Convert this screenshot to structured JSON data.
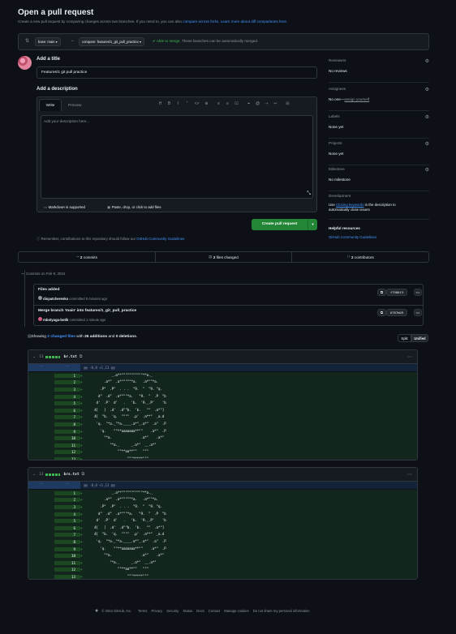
{
  "header": {
    "title": "Open a pull request",
    "subtitle": "Create a new pull request by comparing changes across two branches. If you need to, you can also ",
    "compare_link": "compare across forks.",
    "learn_link": "Learn more about diff comparisons here."
  },
  "compare": {
    "base": "base: main",
    "head": "compare: features/1_git_pull_practice",
    "able": "✔ Able to merge.",
    "able_desc": "These branches can be automatically merged."
  },
  "form": {
    "title_label": "Add a title",
    "title_value": "Features/1 git pull practice",
    "desc_label": "Add a description",
    "tab_write": "Write",
    "tab_preview": "Preview",
    "desc_placeholder": "Add your description here...",
    "markdown_supported": "Markdown is supported",
    "paste_drop": "Paste, drop, or click to add files",
    "create_button": "Create pull request",
    "remember": "Remember, contributions to this repository should follow our ",
    "guidelines": "GitHub Community Guidelines",
    "toolbar_icons": [
      "H",
      "B",
      "I",
      "”",
      "<>",
      "⊕",
      "≡",
      "≡",
      "☑",
      "⌖",
      "@",
      "⇢",
      "↩",
      "⊟"
    ]
  },
  "sidebar": {
    "reviewers": {
      "title": "Reviewers",
      "value": "No reviews"
    },
    "assignees": {
      "title": "Assignees",
      "value": "No one—",
      "link": "assign yourself"
    },
    "labels": {
      "title": "Labels",
      "value": "None yet"
    },
    "projects": {
      "title": "Projects",
      "value": "None yet"
    },
    "milestone": {
      "title": "Milestone",
      "value": "No milestone"
    },
    "development": {
      "title": "Development",
      "desc_pre": "Use ",
      "desc_link": "Closing keywords",
      "desc_post": " in the description to automatically close issues"
    },
    "helpful": {
      "title": "Helpful resources",
      "link": "GitHub Community Guidelines"
    }
  },
  "stats": {
    "commits_num": "2",
    "commits_label": "commits",
    "files_num": "2",
    "files_label": "files changed",
    "contributors_num": "2",
    "contributors_label": "contributors"
  },
  "commits": {
    "date": "Commits on Feb 9, 2024",
    "items": [
      {
        "message": "Files added",
        "author": "dispatcherenko",
        "meta": "committed 9 minutes ago",
        "sha": "f7986f3"
      },
      {
        "message": "Merge branch 'main' into features/1_git_pull_practice",
        "author": "mbotyaga-botik",
        "meta": "committed 1 minute ago",
        "sha": "6787b09"
      }
    ]
  },
  "summary": {
    "showing": "Showing ",
    "files_link": "2 changed files",
    "with": " with ",
    "additions": "26 additions",
    "and": " and ",
    "deletions": "0 deletions",
    "end": ".",
    "split": "Split",
    "unified": "Unified"
  },
  "files": [
    {
      "count": "13",
      "name": "br.txt",
      "hunk": "@@ -0,0 +1,13 @@"
    },
    {
      "count": "13",
      "name": "brs.txt",
      "hunk": "@@ -0,0 +1,13 @@"
    }
  ],
  "ascii_art": [
    "            _.a**\"\"\"\"\"\"\"\"\"\"\"**a._",
    "        .a*\"  .a*\"\"\"\"\"*a.   .a*\"\"*a.",
    "      .P\"  .P\"  . . .  \"9.  \"  \"9. \"q.",
    "     d\"  .d\"  .a*\"\"\"*a.   \"9.  \"  .P  \"b",
    "    d'  .P'  d'   .   'b.  '9._.P'    'b",
    "   4[   [  .d'  .d\"\"b.  'b.   \"\"  .a*\"]",
    "   4[  \"b.  'q.  \"\"\"\"  .p'  .a**\"  _a.d",
    "    'q.  \"*a._\"*a.____.a*\"_.a*\"  .a\"  .P",
    "      'q.    \"\"**aaaaaaa**\"\"    .a*\"  .P",
    "        \"*a.               .a*\"    .a*\"",
    "           \"*a._      _.a*\"  __.a*\"",
    "               \"\"**aa**\"\"   \"\"\"",
    "                    \"\"\"*****\"\"\""
  ],
  "footer": {
    "copyright": "© 2024 GitHub, Inc.",
    "links": [
      "Terms",
      "Privacy",
      "Security",
      "Status",
      "Docs",
      "Contact",
      "Manage cookies",
      "Do not share my personal information"
    ]
  }
}
